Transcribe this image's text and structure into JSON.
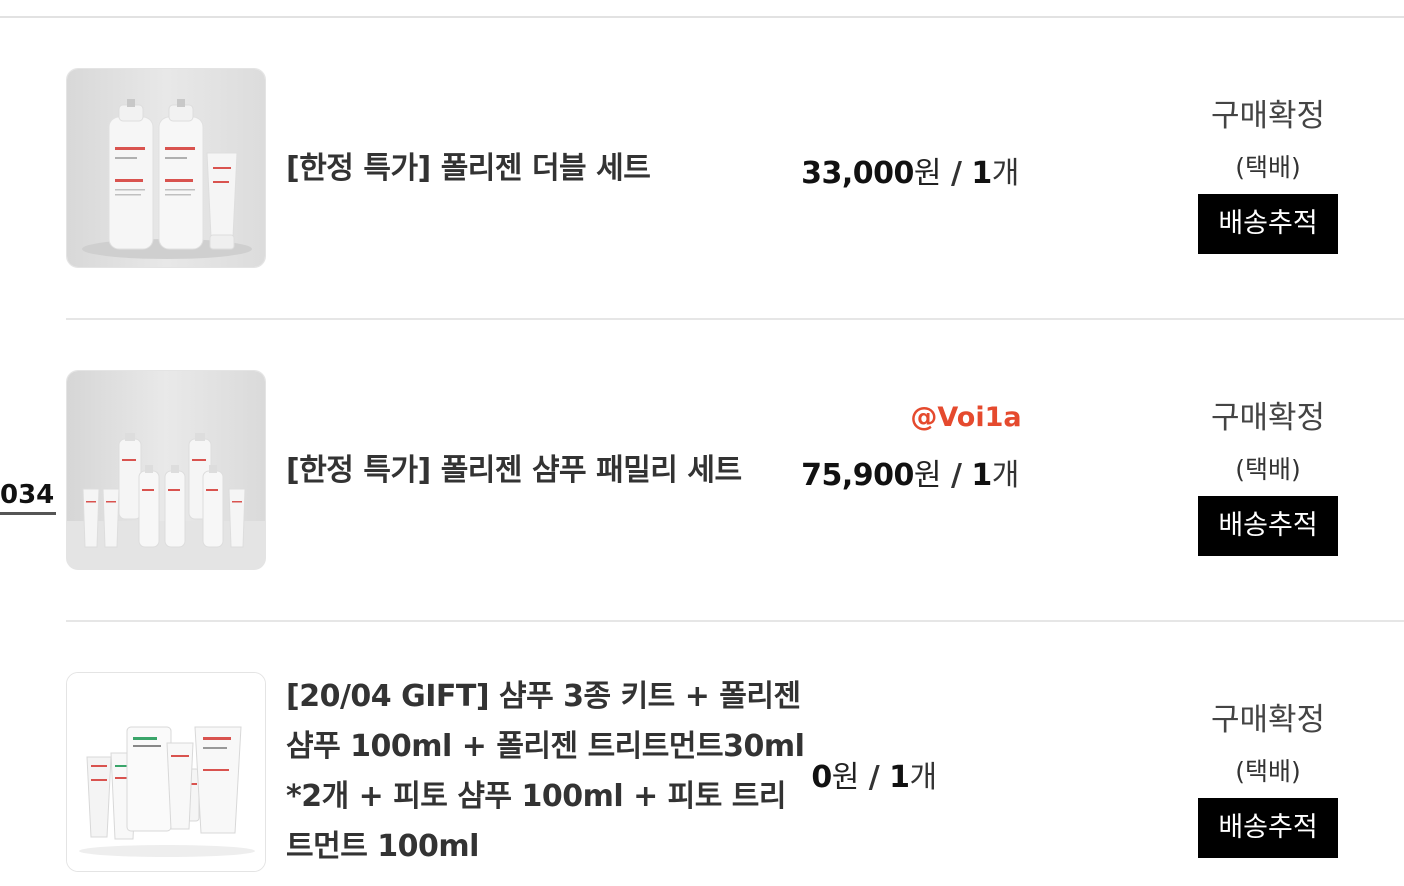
{
  "order": {
    "number_fragment": "034"
  },
  "items": [
    {
      "name": "[한정 특가] 폴리젠 더블 세트",
      "amount": "33,000",
      "currency": "원",
      "qty_sep": " / ",
      "qty_num": "1",
      "qty_unit": "개",
      "status": "구매확정",
      "shipping": "(택배)",
      "track_label": "배송추적",
      "thumb_icon": "product-double-set-image"
    },
    {
      "name": "[한정 특가] 폴리젠 샴푸 패밀리 세트",
      "watermark": "@Voi1a",
      "amount": "75,900",
      "currency": "원",
      "qty_sep": " / ",
      "qty_num": "1",
      "qty_unit": "개",
      "status": "구매확정",
      "shipping": "(택배)",
      "track_label": "배송추적",
      "thumb_icon": "product-family-set-image"
    },
    {
      "name": "[20/04 GIFT] 샴푸 3종 키트 + 폴리젠 샴푸 100ml + 폴리젠 트리트먼트30ml *2개 + 피토 샴푸 100ml + 피토 트리트먼트 100ml",
      "amount": "0",
      "currency": "원",
      "qty_sep": " / ",
      "qty_num": "1",
      "qty_unit": "개",
      "status": "구매확정",
      "shipping": "(택배)",
      "track_label": "배송추적",
      "thumb_icon": "product-gift-kit-image"
    }
  ],
  "colors": {
    "watermark": "#e54a2e",
    "button_bg": "#000000",
    "button_text": "#ffffff",
    "divider": "#e6e6e6"
  }
}
